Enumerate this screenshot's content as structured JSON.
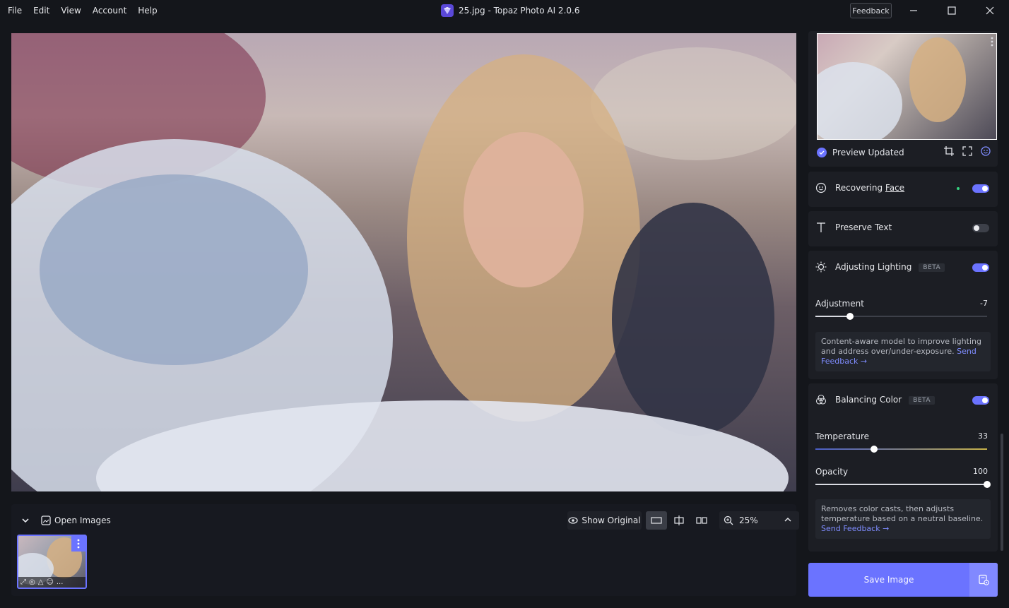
{
  "menu": {
    "file": "File",
    "edit": "Edit",
    "view": "View",
    "account": "Account",
    "help": "Help"
  },
  "window": {
    "title": "25.jpg - Topaz Photo AI 2.0.6",
    "feedback": "Feedback"
  },
  "bottom": {
    "open_images": "Open Images",
    "show_original": "Show Original",
    "zoom": "25%",
    "thumbnail_more": "..."
  },
  "preview": {
    "status": "Preview Updated"
  },
  "filters": {
    "face": {
      "label_prefix": "Recovering ",
      "label_link": "Face",
      "enabled": true
    },
    "text": {
      "label": "Preserve Text",
      "enabled": false
    },
    "lighting": {
      "label": "Adjusting Lighting",
      "badge": "BETA",
      "enabled": true,
      "adjustment_label": "Adjustment",
      "adjustment_value": "-7",
      "adjustment_fraction": 0.2,
      "info": "Content-aware model to improve lighting and address over/under-exposure. ",
      "info_link": "Send Feedback →"
    },
    "color": {
      "label": "Balancing Color",
      "badge": "BETA",
      "enabled": true,
      "temperature_label": "Temperature",
      "temperature_value": "33",
      "temperature_fraction": 0.34,
      "opacity_label": "Opacity",
      "opacity_value": "100",
      "opacity_fraction": 1.0,
      "info": "Removes color casts, then adjusts temperature based on a neutral baseline. ",
      "info_link": "Send Feedback →"
    }
  },
  "save": {
    "label": "Save Image"
  },
  "colors": {
    "accent": "#6b73ff",
    "panel": "#1c1e24",
    "background": "#14161b"
  }
}
